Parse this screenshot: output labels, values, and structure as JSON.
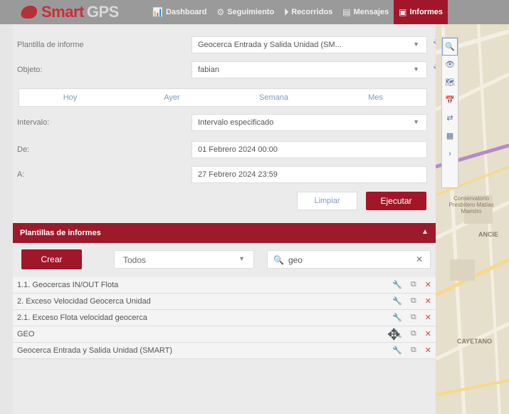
{
  "app": {
    "logo_smart": "Smart",
    "logo_gps": "GPS"
  },
  "nav": [
    {
      "icon": "📊",
      "label": "Dashboard"
    },
    {
      "icon": "⚙",
      "label": "Seguimiento"
    },
    {
      "icon": "⏵",
      "label": "Recorridos"
    },
    {
      "icon": "▤",
      "label": "Mensajes"
    },
    {
      "icon": "▣",
      "label": "Informes"
    }
  ],
  "form": {
    "template_label": "Plantilla de informe",
    "template_value": "Geocerca Entrada y Salida Unidad (SM...",
    "object_label": "Objeto:",
    "object_value": "fabian",
    "quick_dates": [
      "Hoy",
      "Ayer",
      "Semana",
      "Mes"
    ],
    "interval_label": "Intervalo:",
    "interval_value": "Intervalo especificado",
    "from_label": "De:",
    "from_value": "01 Febrero 2024 00:00",
    "to_label": "A:",
    "to_value": "27 Febrero 2024 23:59",
    "clear_label": "Limpiar",
    "run_label": "Ejecutar"
  },
  "templates": {
    "header": "Plantillas de informes",
    "create_label": "Crear",
    "filter_value": "Todos",
    "search_value": "geo",
    "items": [
      {
        "name": "1.1. Geocercas IN/OUT Flota"
      },
      {
        "name": "2. Exceso Velocidad Geocerca Unidad"
      },
      {
        "name": "2.1. Exceso Flota velocidad geocerca"
      },
      {
        "name": "GEO"
      },
      {
        "name": "Geocerca Entrada y Salida Unidad (SMART)"
      }
    ]
  },
  "map": {
    "labels": [
      "Conservatorio Presbítero Matías Maestro",
      "ANCIE",
      "CAYETANO"
    ],
    "toolbar_icons": [
      "search-icon",
      "eye-icon",
      "map-icon",
      "calendar-icon",
      "route-icon",
      "layers-icon",
      "chevron-right-icon"
    ]
  }
}
